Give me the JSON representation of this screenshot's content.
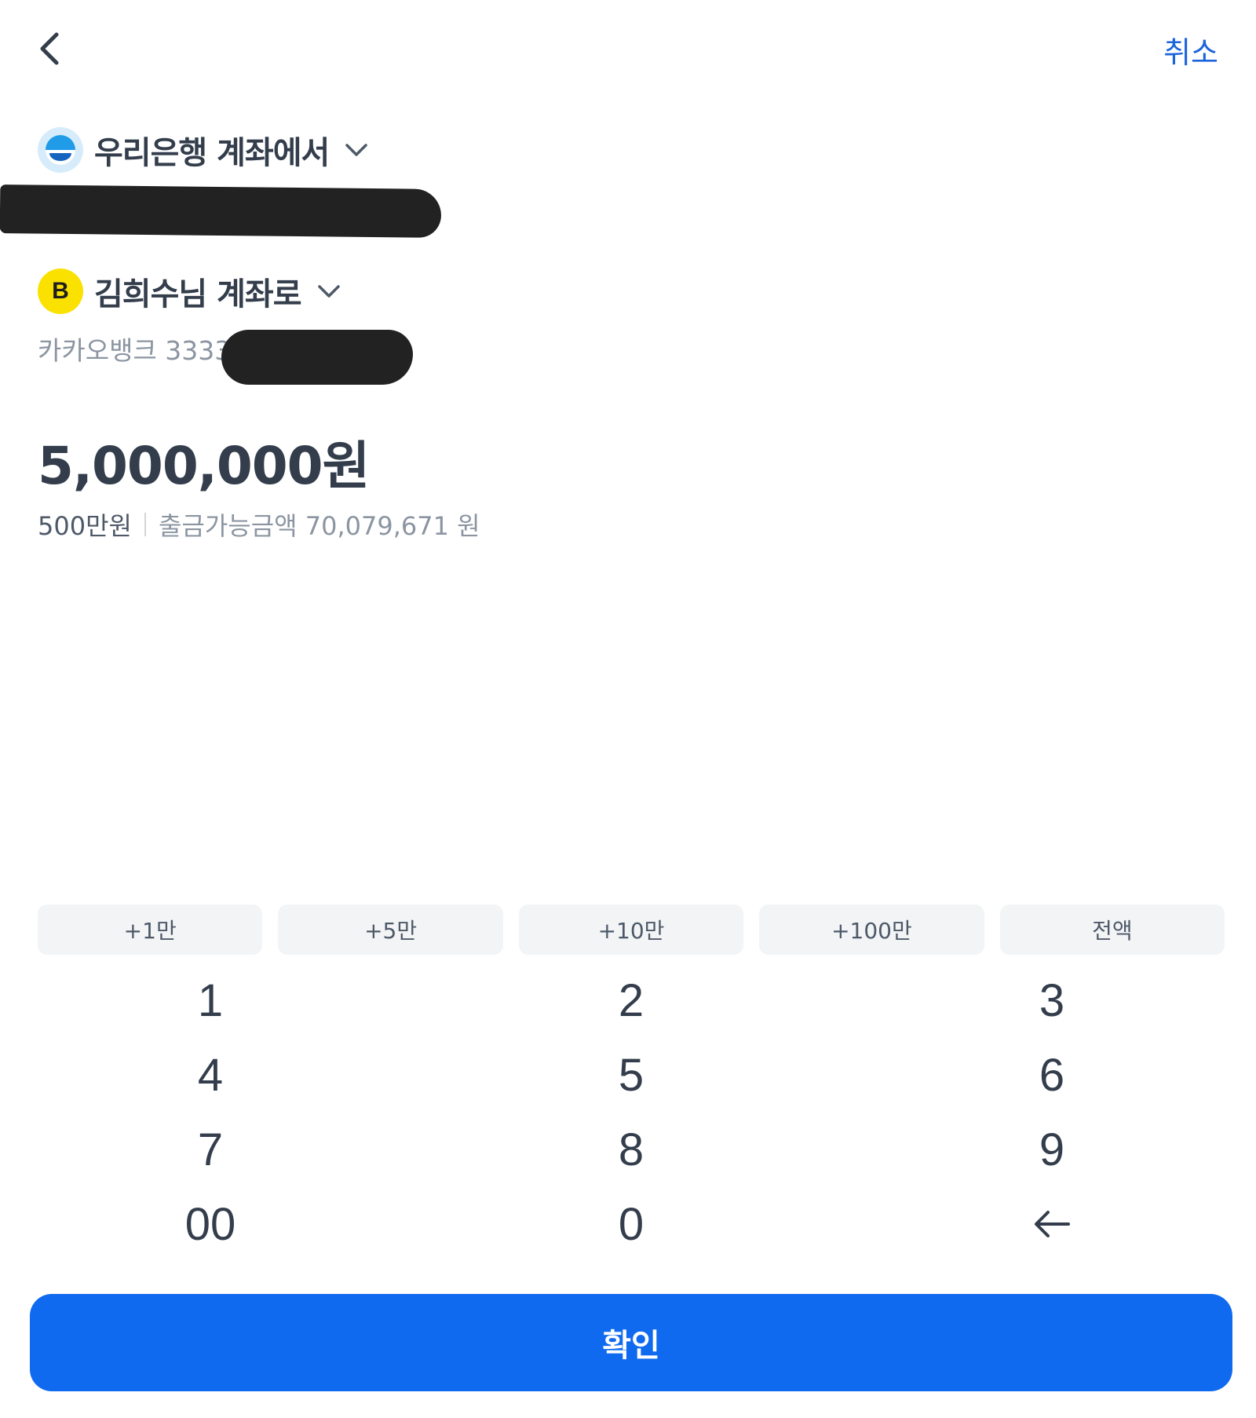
{
  "header": {
    "cancel_label": "취소"
  },
  "from_account": {
    "title": "우리은행 계좌에서",
    "logo_color": "#1f9be8"
  },
  "to_account": {
    "title": "김희수님 계좌로",
    "subtitle": "카카오뱅크 3333",
    "logo_letter": "B",
    "logo_color": "#fae100"
  },
  "amount": {
    "value": "5,000,000원",
    "korean": "500만원",
    "available": "출금가능금액 70,079,671 원"
  },
  "quick_buttons": [
    "+1만",
    "+5만",
    "+10만",
    "+100만",
    "전액"
  ],
  "keypad": {
    "k1": "1",
    "k2": "2",
    "k3": "3",
    "k4": "4",
    "k5": "5",
    "k6": "6",
    "k7": "7",
    "k8": "8",
    "k9": "9",
    "k00": "00",
    "k0": "0"
  },
  "confirm_label": "확인",
  "colors": {
    "accent": "#0f6af0",
    "cancel": "#1b64da"
  }
}
